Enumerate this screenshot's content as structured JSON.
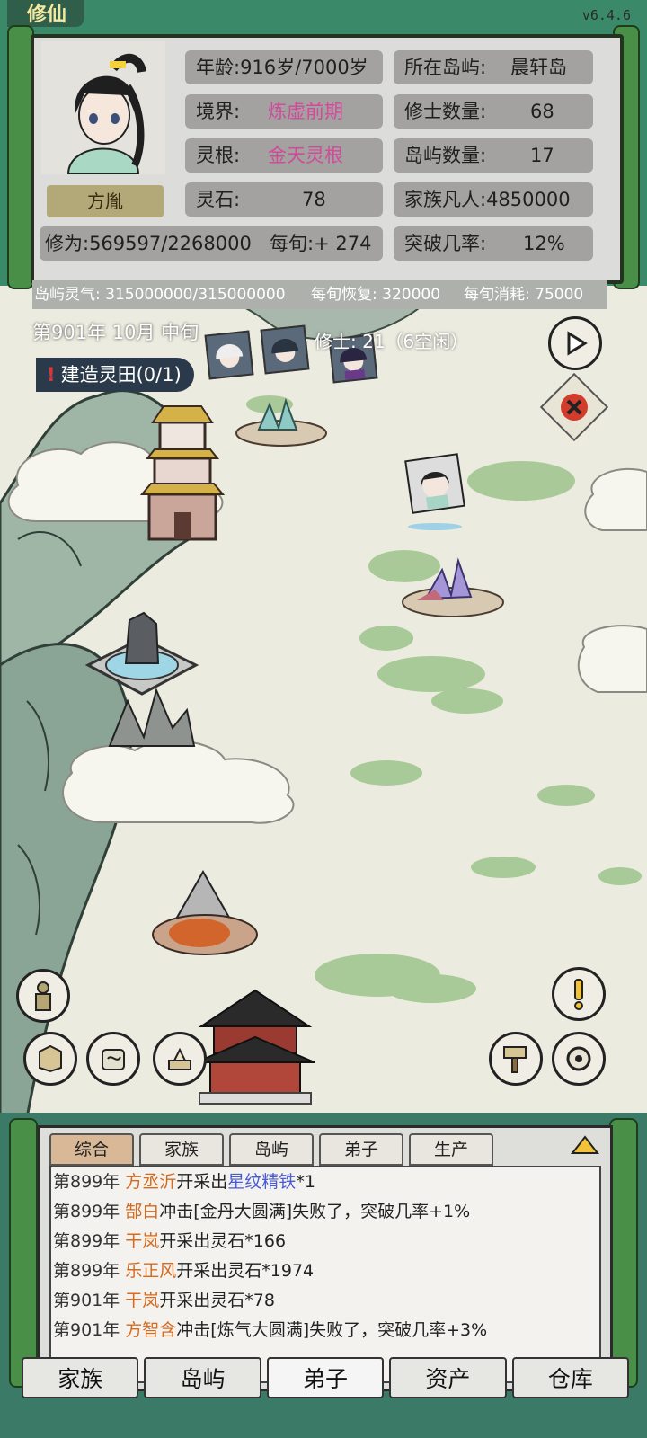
{
  "header": {
    "title": "修仙",
    "version": "v6.4.6"
  },
  "player": {
    "name": "方胤",
    "age": "年龄:916岁/7000岁",
    "realm_label": "境界:",
    "realm_value": "炼虚前期",
    "root_label": "灵根:",
    "root_value": "金天灵根",
    "stones_label": "灵石:",
    "stones_value": "78",
    "cultivation": "修为:569597/2268000",
    "per_turn": "每旬:+ 274",
    "island_label": "所在岛屿:",
    "island_value": "晨轩岛",
    "cultivators_label": "修士数量:",
    "cultivators_value": "68",
    "islands_label": "岛屿数量:",
    "islands_value": "17",
    "mortals": "家族凡人:4850000",
    "breakthrough_label": "突破几率:",
    "breakthrough_value": "12%"
  },
  "resources": {
    "qi": "岛屿灵气: 315000000/315000000",
    "recover": "每旬恢复: 320000",
    "consume": "每旬消耗: 75000"
  },
  "status": {
    "date": "第901年  10月  中旬",
    "cultivators": "修士: 21（6空闲）",
    "task": "建造灵田(0/1)",
    "task_mark": "!"
  },
  "log": {
    "tabs": [
      "综合",
      "家族",
      "岛屿",
      "弟子",
      "生产"
    ],
    "active_tab": 0,
    "entries": [
      {
        "year": "第899年",
        "who": "方丞沂",
        "text": "开采出",
        "item": "星纹精铁",
        "suffix": "*1"
      },
      {
        "year": "第899年",
        "who": "郜白",
        "text": "冲击[金丹大圆满]失败了，突破几率+1%",
        "item": "",
        "suffix": ""
      },
      {
        "year": "第899年",
        "who": "干岚",
        "text": "开采出灵石*166",
        "item": "",
        "suffix": ""
      },
      {
        "year": "第899年",
        "who": "乐正风",
        "text": "开采出灵石*1974",
        "item": "",
        "suffix": ""
      },
      {
        "year": "第901年",
        "who": "干岚",
        "text": "开采出灵石*78",
        "item": "",
        "suffix": ""
      },
      {
        "year": "第901年",
        "who": "方智含",
        "text": "冲击[炼气大圆满]失败了，突破几率+3%",
        "item": "",
        "suffix": ""
      }
    ]
  },
  "nav": [
    "家族",
    "岛屿",
    "弟子",
    "资产",
    "仓库"
  ],
  "colors": {
    "frame": "#3a8a6a",
    "scroll": "#4a8f48",
    "realm_pink": "#d24a9a",
    "log_name": "#d86a1e",
    "log_item": "#4a5bd6"
  }
}
